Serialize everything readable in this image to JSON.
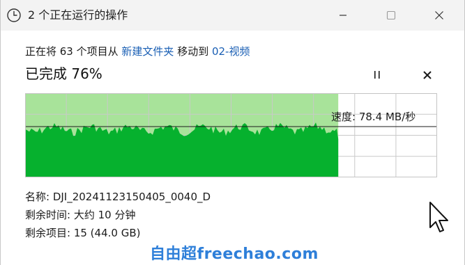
{
  "window": {
    "title": "2 个正在运行的操作",
    "icon": "clock-icon",
    "controls": [
      "minimize-icon",
      "maximize-icon",
      "close-icon"
    ]
  },
  "operation": {
    "prefix": "正在将 63 个项目从 ",
    "source": "新建文件夹",
    "middle": " 移动到 ",
    "destination": "02-视频",
    "status": "已完成 76%",
    "progress_fraction": 0.76,
    "speed": "速度: 78.4 MB/秒"
  },
  "details": {
    "name": "名称:  DJI_20241123150405_0040_D",
    "time_remaining": "剩余时间: 大约 10 分钟",
    "items_remaining": "剩余项目: 15 (44.0 GB)"
  },
  "watermark": "自由超freechao.com",
  "colors": {
    "graph_fill": "#06b12e",
    "graph_background_done": "#a8e39a",
    "grid": "#c9c9c9",
    "link": "#1a5fb4",
    "watermark": "#2e7fd9"
  }
}
